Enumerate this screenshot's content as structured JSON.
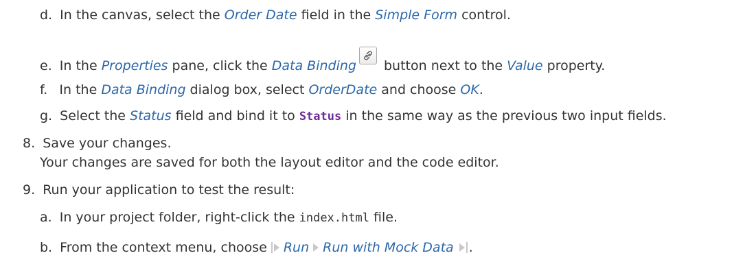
{
  "steps": {
    "d": {
      "marker": "d.",
      "t1": "In the canvas, select the ",
      "e1": "Order Date",
      "t2": " field in the ",
      "e2": "Simple Form",
      "t3": " control."
    },
    "e": {
      "marker": "e.",
      "t1": "In the ",
      "e1": "Properties",
      "t2": " pane, click the ",
      "e2": "Data Binding",
      "t3": " button next to the ",
      "e3": "Value",
      "t4": " property."
    },
    "f": {
      "marker": "f.",
      "t1": "In the ",
      "e1": "Data Binding",
      "t2": " dialog box, select ",
      "e2": "OrderDate",
      "t3": " and choose ",
      "e3": "OK",
      "t4": "."
    },
    "g": {
      "marker": "g.",
      "t1": "Select the ",
      "e1": "Status",
      "t2": " field and bind it to ",
      "code": "Status",
      "t3": " in the same way as the previous two input fields."
    },
    "s8": {
      "marker": "8.",
      "text": "Save your changes.",
      "result": "Your changes are saved for both the layout editor and the code editor."
    },
    "s9": {
      "marker": "9.",
      "text": "Run your application to test the result:"
    },
    "a": {
      "marker": "a.",
      "t1": "In your project folder, right-click the ",
      "code": "index.html",
      "t2": " file."
    },
    "b": {
      "marker": "b.",
      "t1": "From the context menu, choose",
      "m1": "Run",
      "m2": "Run with Mock Data",
      "t2": "."
    }
  },
  "icons": {
    "data_binding": "link-icon",
    "menu_start": "menu-path-start-icon",
    "menu_separator": "menu-path-arrow-icon",
    "menu_end": "menu-path-end-icon"
  },
  "colors": {
    "text": "#333333",
    "emphasis": "#2b67a9",
    "code_bold": "#6e2a96"
  }
}
